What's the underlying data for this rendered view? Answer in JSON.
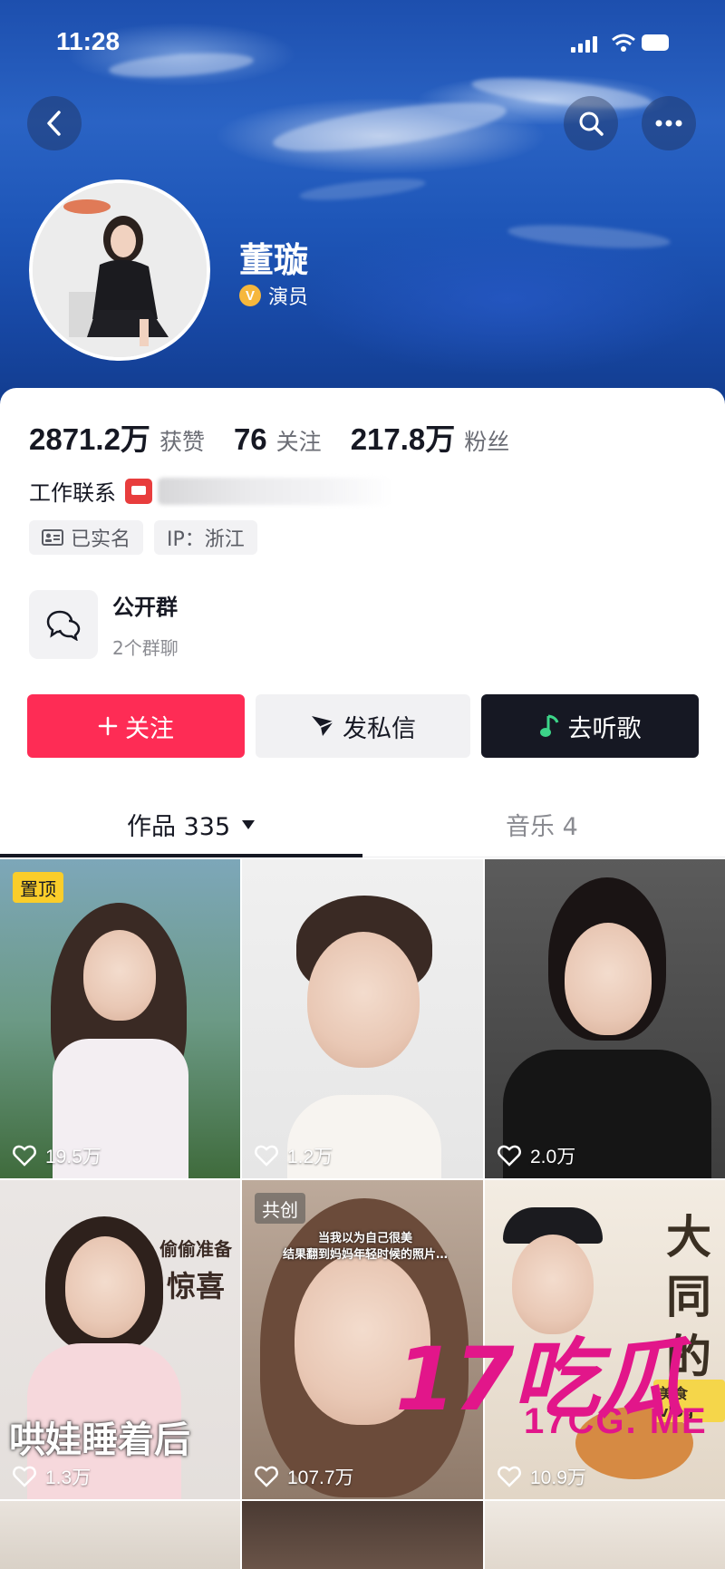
{
  "status_bar": {
    "time": "11:28"
  },
  "profile": {
    "name": "董璇",
    "verified_badge": "V",
    "verified_label": "演员"
  },
  "stats": [
    {
      "value": "2871.2万",
      "label": "获赞"
    },
    {
      "value": "76",
      "label": "关注"
    },
    {
      "value": "217.8万",
      "label": "粉丝"
    }
  ],
  "contact": {
    "label": "工作联系"
  },
  "chips": [
    {
      "icon": "id-card-icon",
      "label": "已实名"
    },
    {
      "icon": "",
      "label": "IP：浙江"
    }
  ],
  "group": {
    "title": "公开群",
    "subtitle": "2个群聊",
    "icon": "chat-bubbles-icon"
  },
  "actions": {
    "follow_label": "关注",
    "message_label": "发私信",
    "music_label": "去听歌"
  },
  "tabs": [
    {
      "label": "作品 335",
      "active": true
    },
    {
      "label": "音乐 4",
      "active": false
    }
  ],
  "videos": [
    {
      "likes": "19.5万",
      "tag": "置顶"
    },
    {
      "likes": "1.2万",
      "tag": ""
    },
    {
      "likes": "2.0万",
      "tag": ""
    },
    {
      "likes": "1.3万",
      "tag": "",
      "caption_main": "哄娃睡着后",
      "caption_side_1": "偷偷准备",
      "caption_side_2": "惊喜"
    },
    {
      "likes": "107.7万",
      "tag": "共创",
      "caption_top": "当我以为自己很美\n结果翻到妈妈年轻时候的照片…"
    },
    {
      "likes": "10.9万",
      "tag": "",
      "caption_main": "大同的",
      "caption_badge": "美食vlog"
    }
  ],
  "watermark": {
    "main": "17吃瓜",
    "sub": "17CG. ME"
  },
  "colors": {
    "accent": "#fe2c55",
    "dark": "#161823",
    "pin_tag": "#facd2a",
    "watermark": "#e2168a"
  }
}
